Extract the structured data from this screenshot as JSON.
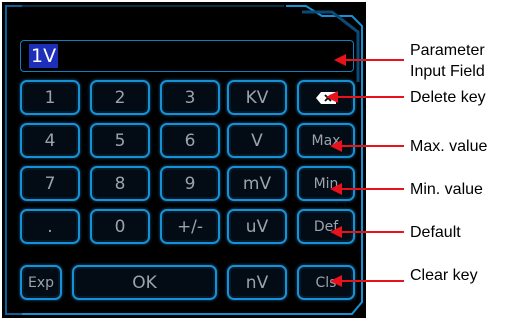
{
  "input": {
    "value": "1V"
  },
  "keys": {
    "k1": "1",
    "k2": "2",
    "k3": "3",
    "kv": "KV",
    "backspace_icon": "backspace-icon",
    "k4": "4",
    "k5": "5",
    "k6": "6",
    "v": "V",
    "max": "Max",
    "k7": "7",
    "k8": "8",
    "k9": "9",
    "mv": "mV",
    "min": "Min",
    "dot": ".",
    "k0": "0",
    "sign": "+/-",
    "uv": "uV",
    "def": "Def",
    "exp": "Exp",
    "ok": "OK",
    "nv": "nV",
    "cls": "Cls"
  },
  "callouts": {
    "parameter_input_line1": "Parameter",
    "parameter_input_line2": "Input Field",
    "delete_key": "Delete key",
    "max_value": "Max. value",
    "min_value": "Min. value",
    "default": "Default",
    "clear_key": "Clear key"
  },
  "colors": {
    "panel_background": "#000000",
    "key_border": "#1791d6",
    "key_text": "#9aa3ad",
    "input_highlight": "#1d2fb8",
    "callout_arrow": "#e8121b"
  }
}
